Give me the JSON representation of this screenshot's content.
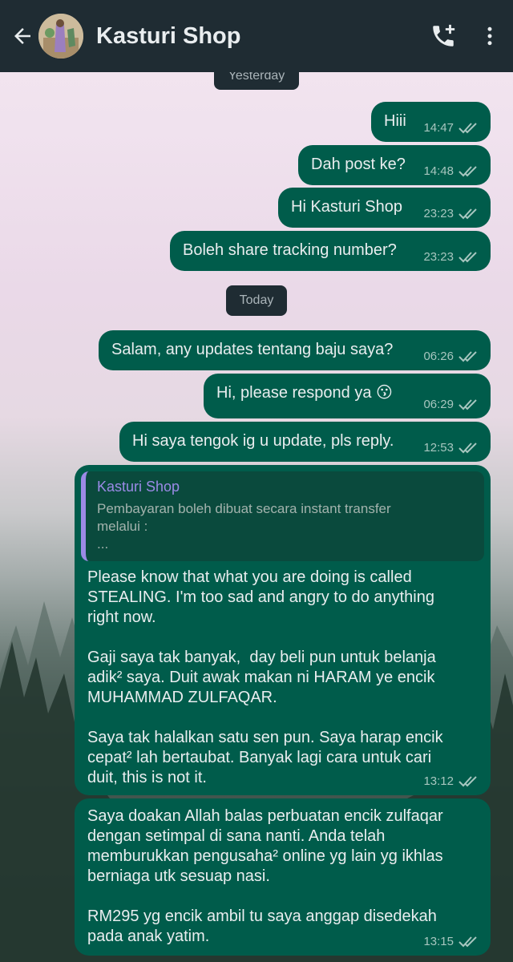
{
  "header": {
    "title": "Kasturi Shop",
    "back_icon": "arrow-left-icon",
    "call_icon": "add-call-icon",
    "menu_icon": "more-vert-icon"
  },
  "colors": {
    "header_bg": "#1f2c33",
    "outgoing_bubble": "#005c4b",
    "quote_accent": "#9b8ae6",
    "tick_color": "#a7c6bf"
  },
  "chat": {
    "yesterday_label": "Yesterday",
    "today_label": "Today",
    "messages": [
      {
        "text": "Hiii",
        "time": "14:47"
      },
      {
        "text": "Dah post ke?",
        "time": "14:48"
      },
      {
        "text": "Hi Kasturi Shop",
        "time": "23:23"
      },
      {
        "text": "Boleh share tracking number?",
        "time": "23:23"
      },
      {
        "text": "Salam, any updates tentang baju saya?",
        "time": "06:26"
      },
      {
        "text": "Hi, please respond ya 😗",
        "time": "06:29"
      },
      {
        "text": "Hi saya tengok ig u update, pls reply.",
        "time": "12:53"
      },
      {
        "quote_author": "Kasturi Shop",
        "quote_text": "Pembayaran boleh dibuat secara instant transfer\nmelalui :\n...",
        "text": "Please know that what you are doing is called\nSTEALING. I'm too sad and angry to do anything\nright now.\n\nGaji saya tak banyak,  day beli pun untuk belanja\nadik² saya. Duit awak makan ni HARAM ye encik\nMUHAMMAD ZULFAQAR.\n\nSaya tak halalkan satu sen pun. Saya harap encik\ncepat² lah bertaubat. Banyak lagi cara untuk cari\nduit, this is not it.",
        "time": "13:12"
      },
      {
        "text": "Saya doakan Allah balas perbuatan encik zulfaqar\ndengan setimpal di sana nanti. Anda telah\nmemburukkan pengusaha² online yg lain yg ikhlas\nberniaga utk sesuap nasi.\n\nRM295 yg encik ambil tu saya anggap disedekah\npada anak yatim.",
        "time": "13:15"
      }
    ]
  }
}
